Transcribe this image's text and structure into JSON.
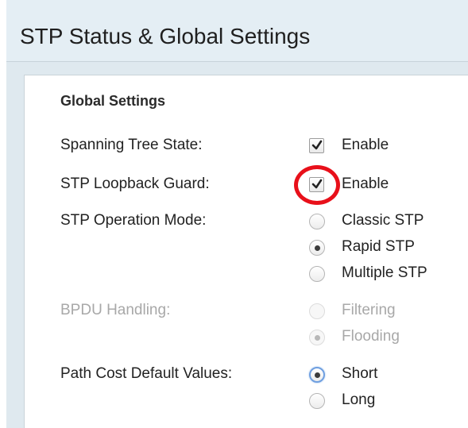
{
  "page": {
    "title": "STP Status & Global Settings"
  },
  "global_settings": {
    "section_title": "Global Settings",
    "spanning_tree_state": {
      "label": "Spanning Tree State:",
      "option": "Enable",
      "checked": true
    },
    "stp_loopback_guard": {
      "label": "STP Loopback Guard:",
      "option": "Enable",
      "checked": true
    },
    "stp_operation_mode": {
      "label": "STP Operation Mode:",
      "options": [
        "Classic STP",
        "Rapid STP",
        "Multiple STP"
      ],
      "selected": "Rapid STP"
    },
    "bpdu_handling": {
      "label": "BPDU Handling:",
      "options": [
        "Filtering",
        "Flooding"
      ],
      "selected": "Flooding",
      "disabled": true
    },
    "path_cost_default_values": {
      "label": "Path Cost Default Values:",
      "options": [
        "Short",
        "Long"
      ],
      "selected": "Short"
    }
  },
  "colors": {
    "highlight": "#e8101a",
    "focus_ring": "#6f9fe0",
    "disabled_text": "#a8a8a8"
  }
}
